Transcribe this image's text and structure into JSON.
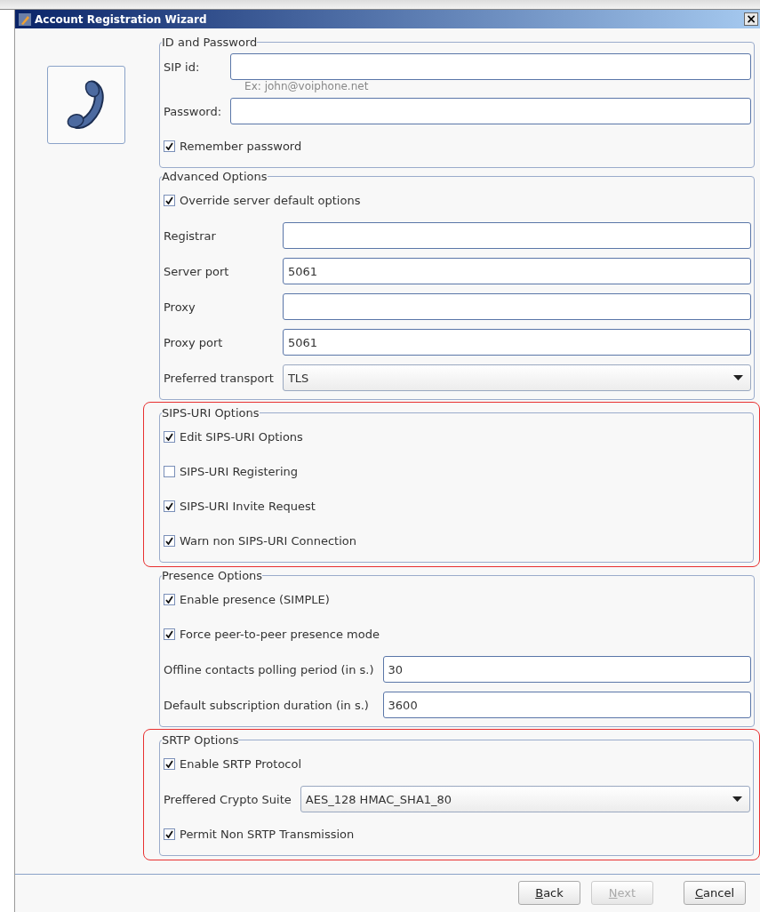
{
  "window": {
    "title": "Account Registration Wizard",
    "close": "×"
  },
  "sections": [
    {
      "title": "ID and Password",
      "highlighted": false,
      "rows": [
        {
          "kind": "field",
          "label": "SIP id:",
          "value": ""
        },
        {
          "kind": "hint",
          "text": "Ex: john@voiphone.net"
        },
        {
          "kind": "field",
          "label": "Password:",
          "value": ""
        },
        {
          "kind": "checkbox",
          "label": "Remember password",
          "checked": true
        }
      ]
    },
    {
      "title": "Advanced Options",
      "highlighted": false,
      "rows": [
        {
          "kind": "checkbox",
          "label": "Override server default options",
          "checked": true
        },
        {
          "kind": "field",
          "label": "Registrar",
          "value": ""
        },
        {
          "kind": "field",
          "label": "Server port",
          "value": "5061"
        },
        {
          "kind": "field",
          "label": "Proxy",
          "value": ""
        },
        {
          "kind": "field",
          "label": "Proxy port",
          "value": "5061"
        },
        {
          "kind": "select",
          "label": "Preferred transport",
          "value": "TLS"
        }
      ]
    },
    {
      "title": "SIPS-URI Options",
      "highlighted": true,
      "rows": [
        {
          "kind": "checkbox",
          "label": "Edit SIPS-URI Options",
          "checked": true
        },
        {
          "kind": "checkbox",
          "label": "SIPS-URI Registering",
          "checked": false
        },
        {
          "kind": "checkbox",
          "label": "SIPS-URI Invite Request",
          "checked": true
        },
        {
          "kind": "checkbox",
          "label": "Warn non SIPS-URI Connection",
          "checked": true
        }
      ]
    },
    {
      "title": "Presence Options",
      "highlighted": false,
      "rows": [
        {
          "kind": "checkbox",
          "label": "Enable presence (SIMPLE)",
          "checked": true
        },
        {
          "kind": "checkbox",
          "label": "Force peer-to-peer presence mode",
          "checked": true
        },
        {
          "kind": "field",
          "label": "Offline contacts polling period (in s.)",
          "value": "30"
        },
        {
          "kind": "field",
          "label": "Default subscription duration (in s.)",
          "value": "3600"
        }
      ]
    },
    {
      "title": "SRTP Options",
      "highlighted": true,
      "rows": [
        {
          "kind": "checkbox",
          "label": "Enable SRTP Protocol",
          "checked": true
        },
        {
          "kind": "select",
          "label": "Preffered Crypto Suite",
          "value": "AES_128 HMAC_SHA1_80"
        },
        {
          "kind": "checkbox",
          "label": "Permit Non SRTP Transmission",
          "checked": true
        }
      ]
    }
  ],
  "buttons": [
    {
      "label": "Back",
      "disabled": false
    },
    {
      "label": "Next",
      "disabled": true
    },
    {
      "label": "Cancel",
      "disabled": false
    }
  ]
}
